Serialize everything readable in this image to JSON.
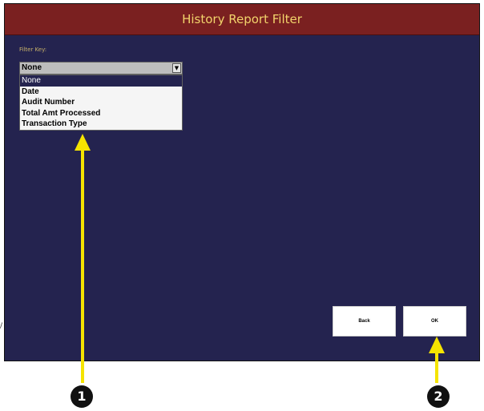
{
  "window": {
    "title": "History Report Filter"
  },
  "filter": {
    "label": "Filter Key:",
    "selected_value": "None",
    "options": [
      "None",
      "Date",
      "Audit Number",
      "Total Amt Processed",
      "Transaction Type"
    ],
    "highlighted_option": "None"
  },
  "buttons": {
    "back_label": "Back",
    "ok_label": "OK"
  },
  "annotations": {
    "callout_1": "1",
    "callout_2": "2",
    "stray_mark": "/"
  },
  "colors": {
    "screen_background": "#24234f",
    "title_bar": "#7a2020",
    "title_text": "#f2d36b",
    "arrow": "#f5e400",
    "callout": "#111111"
  }
}
